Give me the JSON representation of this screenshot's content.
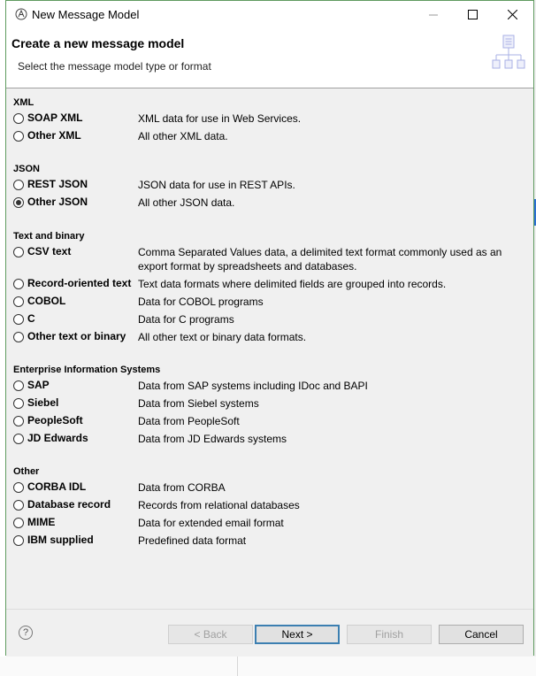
{
  "window": {
    "title": "New Message Model"
  },
  "header": {
    "title": "Create a new message model",
    "subtitle": "Select the message model type or format"
  },
  "groups": [
    {
      "label": "XML",
      "options": [
        {
          "label": "SOAP XML",
          "desc": "XML data for use in Web Services.",
          "checked": false
        },
        {
          "label": "Other XML",
          "desc": "All other XML data.",
          "checked": false
        }
      ]
    },
    {
      "label": "JSON",
      "options": [
        {
          "label": "REST JSON",
          "desc": "JSON data for use in REST APIs.",
          "checked": false
        },
        {
          "label": "Other JSON",
          "desc": "All other JSON data.",
          "checked": true
        }
      ]
    },
    {
      "label": "Text and binary",
      "options": [
        {
          "label": "CSV text",
          "desc": "Comma Separated Values data, a delimited text format commonly used as an export format by spreadsheets and databases.",
          "checked": false
        },
        {
          "label": "Record-oriented text",
          "desc": "Text data formats where delimited fields are grouped into records.",
          "checked": false
        },
        {
          "label": "COBOL",
          "desc": "Data for COBOL programs",
          "checked": false
        },
        {
          "label": "C",
          "desc": "Data for C programs",
          "checked": false
        },
        {
          "label": "Other text or binary",
          "desc": "All other text or binary data formats.",
          "checked": false
        }
      ]
    },
    {
      "label": "Enterprise Information Systems",
      "options": [
        {
          "label": "SAP",
          "desc": "Data from SAP systems including IDoc and BAPI",
          "checked": false
        },
        {
          "label": "Siebel",
          "desc": "Data from Siebel systems",
          "checked": false
        },
        {
          "label": "PeopleSoft",
          "desc": "Data from PeopleSoft",
          "checked": false
        },
        {
          "label": "JD Edwards",
          "desc": "Data from JD Edwards systems",
          "checked": false
        }
      ]
    },
    {
      "label": "Other",
      "options": [
        {
          "label": "CORBA IDL",
          "desc": "Data from CORBA",
          "checked": false
        },
        {
          "label": "Database record",
          "desc": "Records from relational databases",
          "checked": false
        },
        {
          "label": "MIME",
          "desc": "Data for extended email format",
          "checked": false
        },
        {
          "label": "IBM supplied",
          "desc": "Predefined data format",
          "checked": false
        }
      ]
    }
  ],
  "footer": {
    "help": "?",
    "back": "< Back",
    "next": "Next >",
    "finish": "Finish",
    "cancel": "Cancel"
  }
}
